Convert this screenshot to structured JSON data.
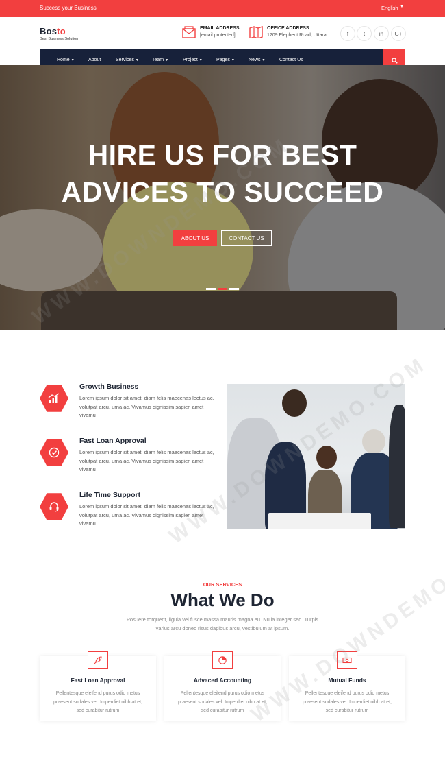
{
  "topbar": {
    "tagline": "Success your Business",
    "language": "English",
    "lang_caret": "▼"
  },
  "brand": {
    "logo_main": "Bos",
    "logo_accent": "to",
    "subtitle": "Best Business Solution"
  },
  "contact": {
    "email_title": "EMAIL ADDRESS",
    "email_value": "[email protected]",
    "office_title": "OFFICE ADDRESS",
    "office_value": "1209 Elephent Road, Uttara"
  },
  "social": {
    "facebook": "f",
    "twitter": "t",
    "linkedin": "in",
    "google": "G+"
  },
  "nav": {
    "items": [
      {
        "label": "Home",
        "caret": "▼"
      },
      {
        "label": "About"
      },
      {
        "label": "Services",
        "caret": "▼"
      },
      {
        "label": "Team",
        "caret": "▼"
      },
      {
        "label": "Project",
        "caret": "▼"
      },
      {
        "label": "Pages",
        "caret": "▼"
      },
      {
        "label": "News",
        "caret": "▼"
      },
      {
        "label": "Contact Us"
      }
    ]
  },
  "hero": {
    "line1": "HIRE US FOR BEST",
    "line2": "ADVICES TO SUCCEED",
    "about_btn": "ABOUT US",
    "contact_btn": "CONTACT US",
    "slides": 3,
    "active_slide": 2
  },
  "features": [
    {
      "title": "Growth Business",
      "desc": "Lorem ipsum dolor sit amet, diam felis maecenas lectus ac, volutpat arcu, urna ac. Vivamus dignissim sapien amet vivamu",
      "icon": "chart-growth-icon"
    },
    {
      "title": "Fast Loan Approval",
      "desc": "Lorem ipsum dolor sit amet, diam felis maecenas lectus ac, volutpat arcu, urna ac. Vivamus dignissim sapien amet vivamu",
      "icon": "check-circle-icon"
    },
    {
      "title": "Life Time Support",
      "desc": "Lorem ipsum dolor sit amet, diam felis maecenas lectus ac, volutpat arcu, urna ac. Vivamus dignissim sapien amet vivamu",
      "icon": "headset-icon"
    }
  ],
  "services": {
    "kicker": "OUR SERVICES",
    "title": "What We Do",
    "desc": "Posuere torquent, ligula vel fusce massa mauris magna eu. Nulla integer sed. Turpis varius arcu donec risus dapibus arcu, vestibulum at ipsum.",
    "cards": [
      {
        "title": "Fast Loan Approval",
        "desc": "Pellentesque eleifend purus odio metus praesent sodales vel. Imperdiet nibh at et, sed curabitur rutrum",
        "icon": "rocket-icon"
      },
      {
        "title": "Advaced Accounting",
        "desc": "Pellentesque eleifend purus odio metus praesent sodales vel. Imperdiet nibh at et, sed curabitur rutrum",
        "icon": "pie-chart-icon"
      },
      {
        "title": "Mutual Funds",
        "desc": "Pellentesque eleifend purus odio metus praesent sodales vel. Imperdiet nibh at et, sed curabitur rutrum",
        "icon": "money-icon"
      }
    ]
  },
  "watermark": "WWW.DOWNDEMO.COM",
  "colors": {
    "accent": "#f23f3f",
    "navy": "#17213a"
  }
}
